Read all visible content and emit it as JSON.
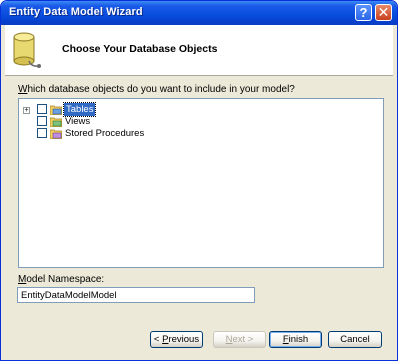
{
  "window": {
    "title": "Entity Data Model Wizard"
  },
  "header": {
    "title": "Choose Your Database Objects"
  },
  "tree": {
    "prompt": "Which database objects do you want to include in your model?",
    "items": [
      {
        "label": "Tables",
        "checked": false,
        "expanded": false,
        "selected": true
      },
      {
        "label": "Views",
        "checked": false,
        "selected": false
      },
      {
        "label": "Stored Procedures",
        "checked": false,
        "selected": false
      }
    ]
  },
  "namespace": {
    "label": "Model Namespace:",
    "value": "EntityDataModelModel"
  },
  "buttons": {
    "previous": "< Previous",
    "next": "Next >",
    "finish": "Finish",
    "cancel": "Cancel"
  },
  "colors": {
    "titlebar": "#0a4fdf",
    "selection": "#316ac5",
    "dialog_bg": "#ece9d8"
  }
}
